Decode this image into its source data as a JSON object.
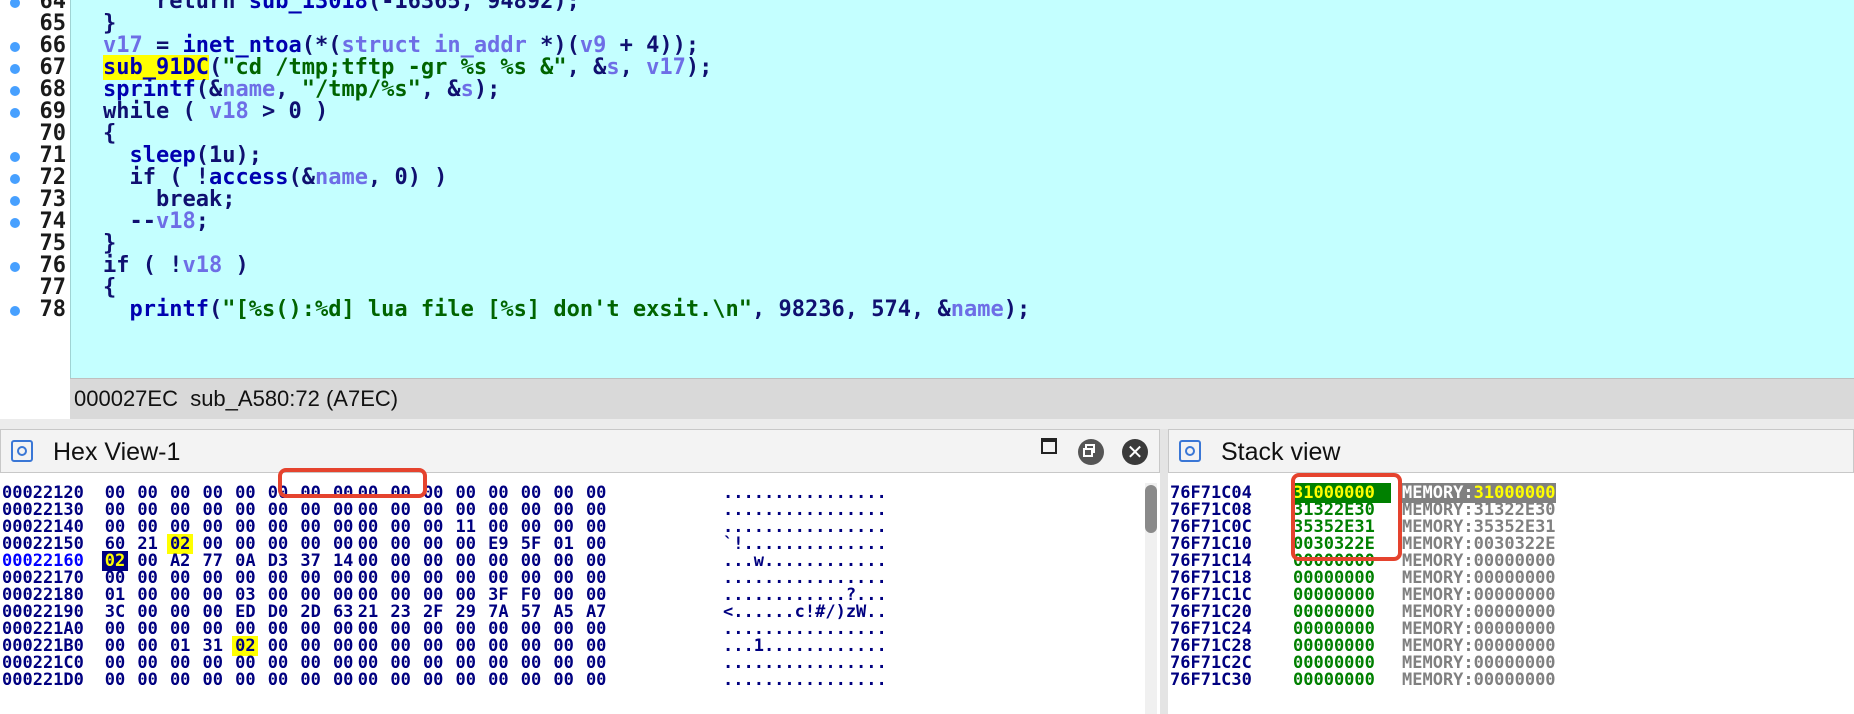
{
  "pseudocode": {
    "lines": [
      {
        "num": "64",
        "dot": true,
        "tokens": [
          [
            "    ",
            "op"
          ],
          [
            "return",
            "kw"
          ],
          [
            " ",
            "op"
          ],
          [
            "sub_13018",
            "fn"
          ],
          [
            "(-16365, 94892);",
            "op"
          ]
        ]
      },
      {
        "num": "65",
        "dot": false,
        "tokens": [
          [
            "}",
            "op"
          ]
        ]
      },
      {
        "num": "66",
        "dot": true,
        "tokens": [
          [
            "v17",
            "var"
          ],
          [
            " = ",
            "op"
          ],
          [
            "inet_ntoa",
            "fn"
          ],
          [
            "(*(",
            "op"
          ],
          [
            "struct in_addr",
            "var"
          ],
          [
            " *)(",
            "op"
          ],
          [
            "v9",
            "var"
          ],
          [
            " + 4));",
            "op"
          ]
        ]
      },
      {
        "num": "67",
        "dot": true,
        "tokens": [
          [
            "sub_91DC",
            "hl"
          ],
          [
            "(",
            "op"
          ],
          [
            "\"cd /tmp;tftp -gr %s %s &\"",
            "str"
          ],
          [
            ", &",
            "op"
          ],
          [
            "s",
            "var"
          ],
          [
            ", ",
            "op"
          ],
          [
            "v17",
            "var"
          ],
          [
            ");",
            "op"
          ]
        ]
      },
      {
        "num": "68",
        "dot": true,
        "tokens": [
          [
            "sprintf",
            "fn"
          ],
          [
            "(&",
            "op"
          ],
          [
            "name",
            "var"
          ],
          [
            ", ",
            "op"
          ],
          [
            "\"/tmp/%s\"",
            "str"
          ],
          [
            ", &",
            "op"
          ],
          [
            "s",
            "var"
          ],
          [
            ");",
            "op"
          ]
        ]
      },
      {
        "num": "69",
        "dot": true,
        "tokens": [
          [
            "while",
            "kw"
          ],
          [
            " ( ",
            "op"
          ],
          [
            "v18",
            "var"
          ],
          [
            " > 0 )",
            "op"
          ]
        ]
      },
      {
        "num": "70",
        "dot": false,
        "tokens": [
          [
            "{",
            "op"
          ]
        ]
      },
      {
        "num": "71",
        "dot": true,
        "tokens": [
          [
            "  ",
            "op"
          ],
          [
            "sleep",
            "fn"
          ],
          [
            "(1u);",
            "op"
          ]
        ]
      },
      {
        "num": "72",
        "dot": true,
        "tokens": [
          [
            "  ",
            "op"
          ],
          [
            "if",
            "kw"
          ],
          [
            " ( !",
            "op"
          ],
          [
            "access",
            "fn"
          ],
          [
            "(&",
            "op"
          ],
          [
            "name",
            "var"
          ],
          [
            ", 0) )",
            "op"
          ]
        ]
      },
      {
        "num": "73",
        "dot": true,
        "tokens": [
          [
            "    ",
            "op"
          ],
          [
            "break",
            "kw"
          ],
          [
            ";",
            "op"
          ]
        ]
      },
      {
        "num": "74",
        "dot": true,
        "tokens": [
          [
            "  --",
            "op"
          ],
          [
            "v18",
            "var"
          ],
          [
            ";",
            "op"
          ]
        ]
      },
      {
        "num": "75",
        "dot": false,
        "tokens": [
          [
            "}",
            "op"
          ]
        ]
      },
      {
        "num": "76",
        "dot": true,
        "tokens": [
          [
            "if",
            "kw"
          ],
          [
            " ( !",
            "op"
          ],
          [
            "v18",
            "var"
          ],
          [
            " )",
            "op"
          ]
        ]
      },
      {
        "num": "77",
        "dot": false,
        "tokens": [
          [
            "{",
            "op"
          ]
        ]
      },
      {
        "num": "78",
        "dot": true,
        "tokens": [
          [
            "  ",
            "op"
          ],
          [
            "printf",
            "fn"
          ],
          [
            "(",
            "op"
          ],
          [
            "\"[%s():%d] lua file [%s] don't exsit.\\n\"",
            "str"
          ],
          [
            ", 98236, 574, &",
            "op"
          ],
          [
            "name",
            "var"
          ],
          [
            ");",
            "op"
          ]
        ]
      }
    ]
  },
  "status_bar": {
    "text": "000027EC  sub_A580:72 (A7EC)"
  },
  "hex_view": {
    "title": "Hex View-1",
    "rows": [
      {
        "addr": "00022120",
        "bytes": [
          "00",
          "00",
          "00",
          "00",
          "00",
          "00",
          "00",
          "00",
          "00",
          "00",
          "00",
          "00",
          "00",
          "00",
          "00",
          "00"
        ],
        "ascii": "................"
      },
      {
        "addr": "00022130",
        "bytes": [
          "00",
          "00",
          "00",
          "00",
          "00",
          "00",
          "00",
          "00",
          "00",
          "00",
          "00",
          "00",
          "00",
          "00",
          "00",
          "00"
        ],
        "ascii": "................"
      },
      {
        "addr": "00022140",
        "bytes": [
          "00",
          "00",
          "00",
          "00",
          "00",
          "00",
          "00",
          "00",
          "00",
          "00",
          "00",
          "11",
          "00",
          "00",
          "00",
          "00"
        ],
        "ascii": "................"
      },
      {
        "addr": "00022150",
        "bytes": [
          "60",
          "21",
          "02",
          "00",
          "00",
          "00",
          "00",
          "00",
          "00",
          "00",
          "00",
          "00",
          "E9",
          "5F",
          "01",
          "00"
        ],
        "ascii": "`!..............",
        "highlight": [
          2
        ]
      },
      {
        "addr": "00022160",
        "bytes": [
          "02",
          "00",
          "A2",
          "77",
          "0A",
          "D3",
          "37",
          "14",
          "00",
          "00",
          "00",
          "00",
          "00",
          "00",
          "00",
          "00"
        ],
        "ascii": "...w............",
        "current": true,
        "selected": [
          0
        ]
      },
      {
        "addr": "00022170",
        "bytes": [
          "00",
          "00",
          "00",
          "00",
          "00",
          "00",
          "00",
          "00",
          "00",
          "00",
          "00",
          "00",
          "00",
          "00",
          "00",
          "00"
        ],
        "ascii": "................"
      },
      {
        "addr": "00022180",
        "bytes": [
          "01",
          "00",
          "00",
          "00",
          "03",
          "00",
          "00",
          "00",
          "00",
          "00",
          "00",
          "00",
          "3F",
          "F0",
          "00",
          "00"
        ],
        "ascii": "............?..."
      },
      {
        "addr": "00022190",
        "bytes": [
          "3C",
          "00",
          "00",
          "00",
          "ED",
          "D0",
          "2D",
          "63",
          "21",
          "23",
          "2F",
          "29",
          "7A",
          "57",
          "A5",
          "A7"
        ],
        "ascii": "<......c!#/)zW.."
      },
      {
        "addr": "000221A0",
        "bytes": [
          "00",
          "00",
          "00",
          "00",
          "00",
          "00",
          "00",
          "00",
          "00",
          "00",
          "00",
          "00",
          "00",
          "00",
          "00",
          "00"
        ],
        "ascii": "................"
      },
      {
        "addr": "000221B0",
        "bytes": [
          "00",
          "00",
          "01",
          "31",
          "02",
          "00",
          "00",
          "00",
          "00",
          "00",
          "00",
          "00",
          "00",
          "00",
          "00",
          "00"
        ],
        "ascii": "...1............",
        "highlight": [
          4
        ]
      },
      {
        "addr": "000221C0",
        "bytes": [
          "00",
          "00",
          "00",
          "00",
          "00",
          "00",
          "00",
          "00",
          "00",
          "00",
          "00",
          "00",
          "00",
          "00",
          "00",
          "00"
        ],
        "ascii": "................"
      },
      {
        "addr": "000221D0",
        "bytes": [
          "00",
          "00",
          "00",
          "00",
          "00",
          "00",
          "00",
          "00",
          "00",
          "00",
          "00",
          "00",
          "00",
          "00",
          "00",
          "00"
        ],
        "ascii": "................"
      }
    ]
  },
  "stack_view": {
    "title": "Stack view",
    "rows": [
      {
        "addr": "76F71C04",
        "value": "31000000",
        "comment_prefix": "MEMORY:",
        "comment_value": "31000000",
        "current": true
      },
      {
        "addr": "76F71C08",
        "value": "31322E30",
        "comment_prefix": "MEMORY:",
        "comment_value": "31322E30"
      },
      {
        "addr": "76F71C0C",
        "value": "35352E31",
        "comment_prefix": "MEMORY:",
        "comment_value": "35352E31"
      },
      {
        "addr": "76F71C10",
        "value": "0030322E",
        "comment_prefix": "MEMORY:",
        "comment_value": "0030322E"
      },
      {
        "addr": "76F71C14",
        "value": "00000000",
        "comment_prefix": "MEMORY:",
        "comment_value": "00000000"
      },
      {
        "addr": "76F71C18",
        "value": "00000000",
        "comment_prefix": "MEMORY:",
        "comment_value": "00000000"
      },
      {
        "addr": "76F71C1C",
        "value": "00000000",
        "comment_prefix": "MEMORY:",
        "comment_value": "00000000"
      },
      {
        "addr": "76F71C20",
        "value": "00000000",
        "comment_prefix": "MEMORY:",
        "comment_value": "00000000"
      },
      {
        "addr": "76F71C24",
        "value": "00000000",
        "comment_prefix": "MEMORY:",
        "comment_value": "00000000"
      },
      {
        "addr": "76F71C28",
        "value": "00000000",
        "comment_prefix": "MEMORY:",
        "comment_value": "00000000"
      },
      {
        "addr": "76F71C2C",
        "value": "00000000",
        "comment_prefix": "MEMORY:",
        "comment_value": "00000000"
      },
      {
        "addr": "76F71C30",
        "value": "00000000",
        "comment_prefix": "MEMORY:",
        "comment_value": "00000000"
      }
    ]
  },
  "icons": {
    "panel": "ida-view-icon",
    "maximize": "maximize-icon",
    "float": "float-window-icon",
    "close": "close-icon",
    "close_glyph": "✕"
  },
  "colors": {
    "code_bg": "#c4ffff",
    "string": "#006400",
    "variable": "#6e6ee6",
    "function": "#0000b0",
    "highlight": "#ffff00",
    "annotation": "#e5432e",
    "stack_value": "#008000"
  }
}
